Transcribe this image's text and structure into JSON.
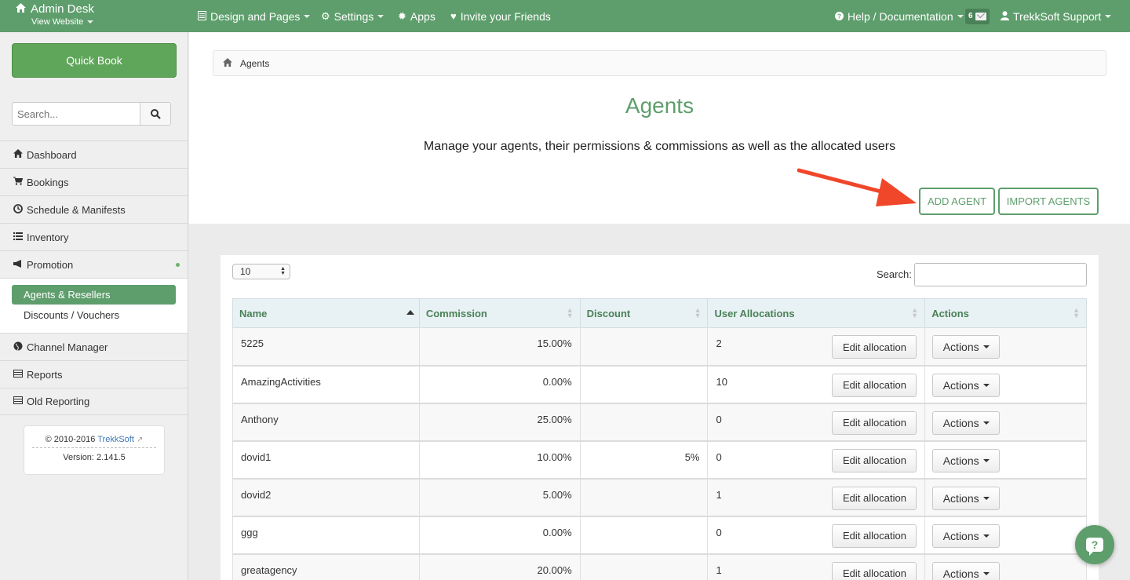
{
  "topbar": {
    "brand_title": "Admin Desk",
    "brand_sub": "View Website",
    "nav": [
      {
        "label": "Design and Pages",
        "icon": "pages-icon"
      },
      {
        "label": "Settings",
        "icon": "gear-icon"
      },
      {
        "label": "Apps",
        "icon": "apps-icon"
      },
      {
        "label": "Invite your Friends",
        "icon": "heart-icon"
      }
    ],
    "help_label": "Help / Documentation",
    "mail_count": "6",
    "user_label": "TrekkSoft Support"
  },
  "sidebar": {
    "quick_book": "Quick Book",
    "search_placeholder": "Search...",
    "items": [
      {
        "label": "Dashboard",
        "icon": "home-icon"
      },
      {
        "label": "Bookings",
        "icon": "cart-icon"
      },
      {
        "label": "Schedule & Manifests",
        "icon": "clock-icon"
      },
      {
        "label": "Inventory",
        "icon": "list-icon"
      },
      {
        "label": "Promotion",
        "icon": "megaphone-icon"
      }
    ],
    "submenu": {
      "active": "Agents & Resellers",
      "other": "Discounts / Vouchers"
    },
    "items_after": [
      {
        "label": "Channel Manager",
        "icon": "globe-icon"
      },
      {
        "label": "Reports",
        "icon": "table-icon"
      },
      {
        "label": "Old Reporting",
        "icon": "table-icon"
      }
    ],
    "copyright_prefix": "© 2010-2016",
    "copyright_link": "TrekkSoft",
    "version": "Version: 2.141.5"
  },
  "breadcrumb": {
    "current": "Agents"
  },
  "page": {
    "title": "Agents",
    "description": "Manage your agents, their permissions & commissions as well as the allocated users",
    "add_agent": "ADD AGENT",
    "import_agents": "IMPORT AGENTS"
  },
  "table_controls": {
    "page_length": "10",
    "search_label": "Search:"
  },
  "table": {
    "headers": [
      "Name",
      "Commission",
      "Discount",
      "User Allocations",
      "Actions"
    ],
    "edit_label": "Edit allocation",
    "actions_label": "Actions",
    "rows": [
      {
        "name": "5225",
        "commission": "15.00%",
        "discount": "",
        "allocations": "2"
      },
      {
        "name": "AmazingActivities",
        "commission": "0.00%",
        "discount": "",
        "allocations": "10"
      },
      {
        "name": "Anthony",
        "commission": "25.00%",
        "discount": "",
        "allocations": "0"
      },
      {
        "name": "dovid1",
        "commission": "10.00%",
        "discount": "5%",
        "allocations": "0"
      },
      {
        "name": "dovid2",
        "commission": "5.00%",
        "discount": "",
        "allocations": "1"
      },
      {
        "name": "ggg",
        "commission": "0.00%",
        "discount": "",
        "allocations": "0"
      },
      {
        "name": "greatagency",
        "commission": "20.00%",
        "discount": "",
        "allocations": "1"
      }
    ]
  },
  "colors": {
    "brand": "#5e9e6c",
    "arrow": "#f0462a"
  }
}
